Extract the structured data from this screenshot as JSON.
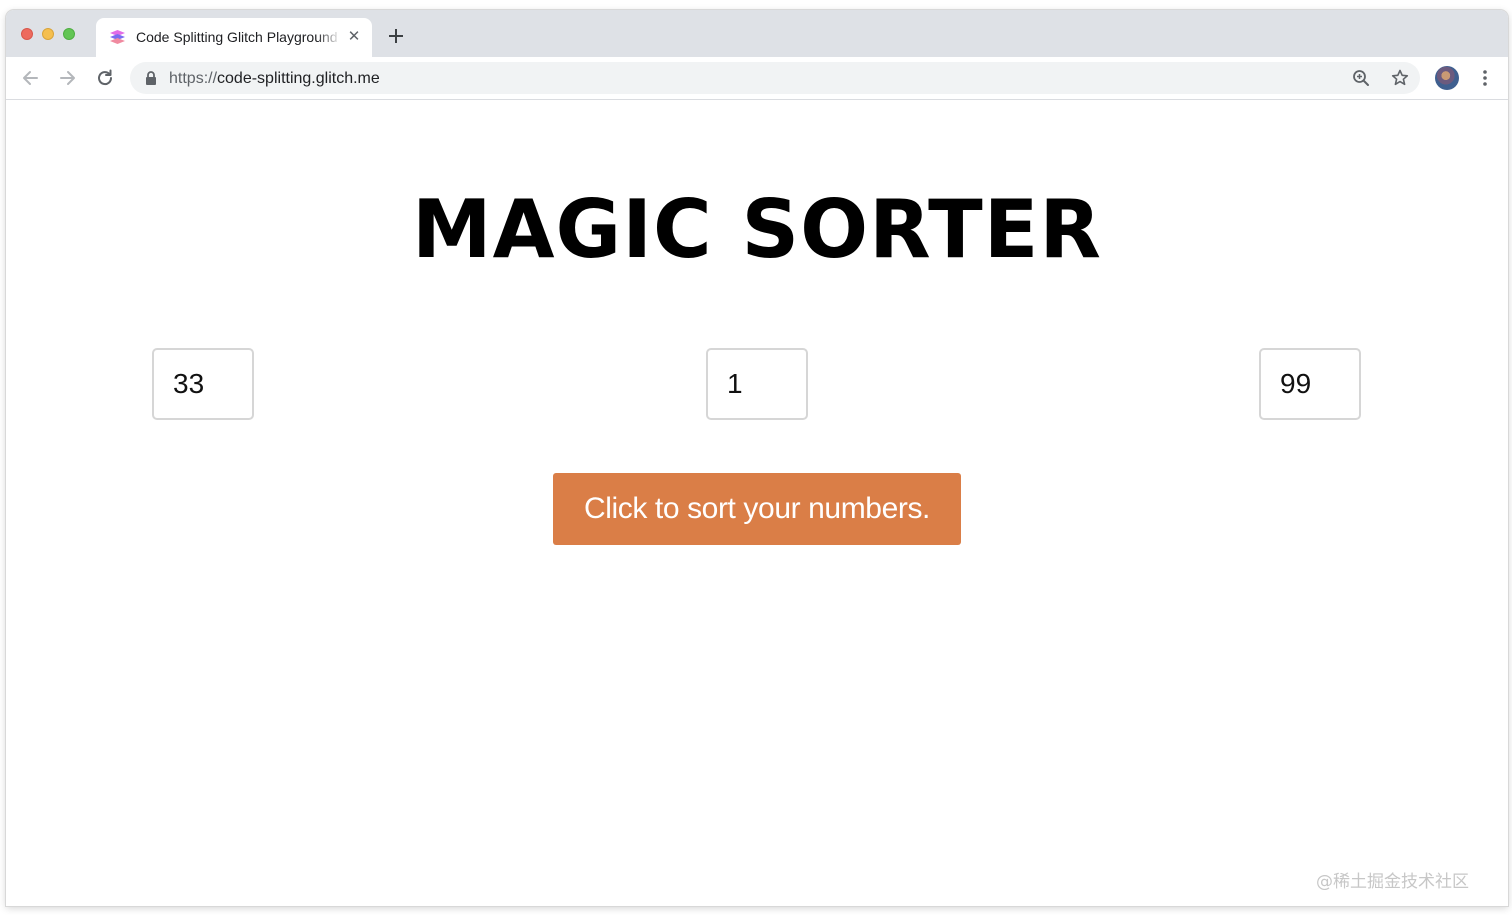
{
  "browser": {
    "tab": {
      "title": "Code Splitting Glitch Playground",
      "close_glyph": "✕",
      "favicon": "glitch-favicon-icon"
    },
    "new_tab_icon": "plus-icon",
    "url_scheme": "https://",
    "url_host": "code-splitting.glitch.me",
    "icons": {
      "back": "arrow-left-icon",
      "forward": "arrow-right-icon",
      "reload": "reload-icon",
      "lock": "lock-icon",
      "zoom": "zoom-icon",
      "bookmark": "star-icon",
      "menu": "kebab-menu-icon"
    }
  },
  "page": {
    "title": "MAGIC SORTER",
    "inputs": [
      "33",
      "1",
      "99"
    ],
    "button_label": "Click to sort your numbers.",
    "button_color": "#da7e47"
  },
  "watermark": "@稀土掘金技术社区"
}
